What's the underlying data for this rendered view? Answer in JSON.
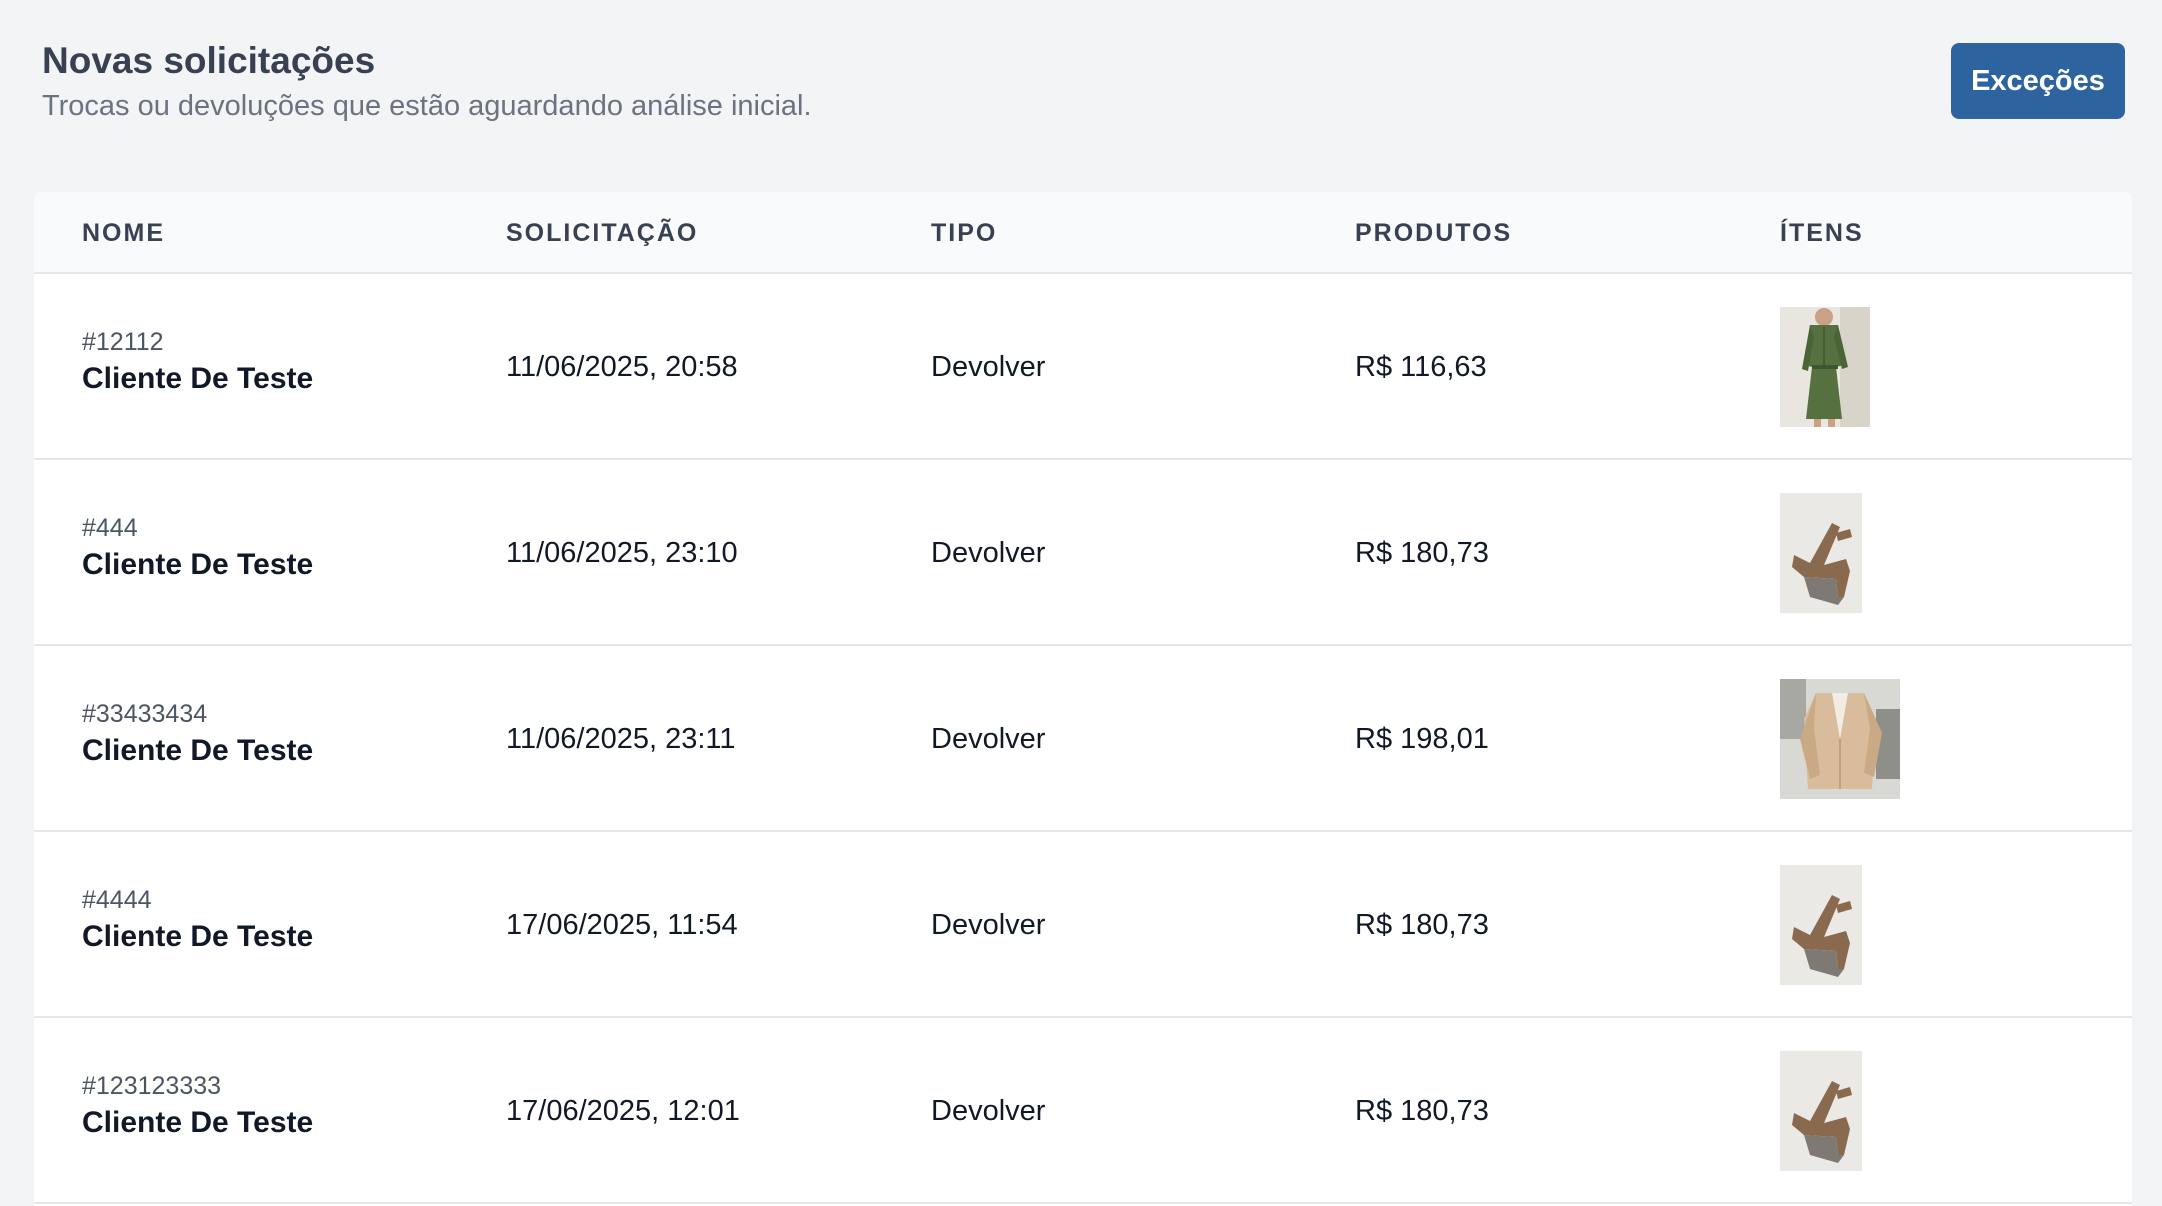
{
  "header": {
    "title": "Novas solicitações",
    "subtitle": "Trocas ou devoluções que estão aguardando análise inicial."
  },
  "actions": {
    "exceptions_label": "Exceções",
    "accent": "#2d64a0"
  },
  "table": {
    "columns": [
      "NOME",
      "SOLICITAÇÃO",
      "TIPO",
      "PRODUTOS",
      "ÍTENS"
    ],
    "rows": [
      {
        "id": "#12112",
        "name": "Cliente De Teste",
        "date": "11/06/2025, 20:58",
        "type": "Devolver",
        "amount": "R$ 116,63",
        "item_icon": "green-dress-image"
      },
      {
        "id": "#444",
        "name": "Cliente De Teste",
        "date": "11/06/2025, 23:10",
        "type": "Devolver",
        "amount": "R$ 180,73",
        "item_icon": "wedge-sandal-image"
      },
      {
        "id": "#33433434",
        "name": "Cliente De Teste",
        "date": "11/06/2025, 23:11",
        "type": "Devolver",
        "amount": "R$ 198,01",
        "item_icon": "beige-blazer-image"
      },
      {
        "id": "#4444",
        "name": "Cliente De Teste",
        "date": "17/06/2025, 11:54",
        "type": "Devolver",
        "amount": "R$ 180,73",
        "item_icon": "wedge-sandal-image"
      },
      {
        "id": "#123123333",
        "name": "Cliente De Teste",
        "date": "17/06/2025, 12:01",
        "type": "Devolver",
        "amount": "R$ 180,73",
        "item_icon": "wedge-sandal-image"
      }
    ]
  }
}
